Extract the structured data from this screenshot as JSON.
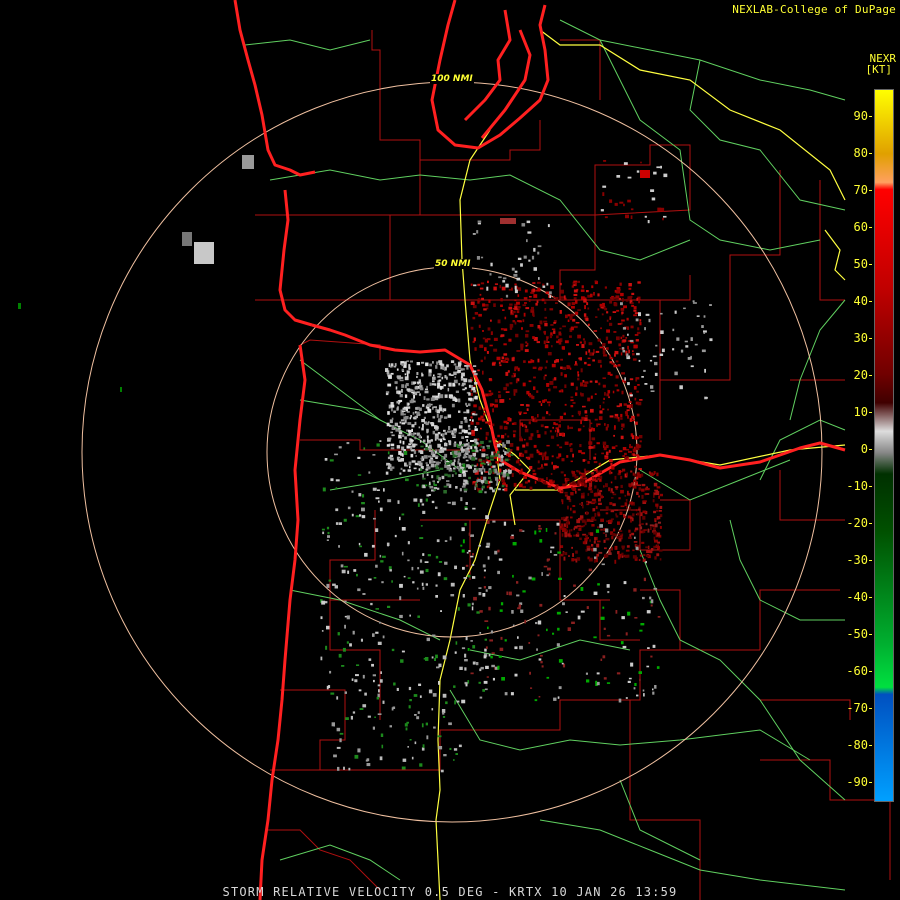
{
  "credit": "NEXLAB-College of DuPage",
  "product": "NEXR",
  "unit": "[KT]",
  "footer": "STORM RELATIVE VELOCITY 0.5 DEG - KRTX 10 JAN 26 13:59",
  "rings": [
    {
      "label": "100 NMI"
    },
    {
      "label": "50 NMI"
    }
  ],
  "legend": {
    "ticks": [
      "90",
      "80",
      "70",
      "60",
      "50",
      "40",
      "30",
      "20",
      "10",
      "0",
      "-10",
      "-20",
      "-30",
      "-40",
      "-50",
      "-60",
      "-70",
      "-80",
      "-90"
    ],
    "colors": {
      "high": "#ffff00",
      "orange": "#ffa060",
      "red": "#ff0000",
      "darkred": "#700000",
      "gray": "#888888",
      "darkgreen": "#005000",
      "green": "#00e040",
      "blue": "#0050c0",
      "lightblue": "#00a0ff"
    }
  },
  "colors": {
    "background": "#000000",
    "coast": "#ff2020",
    "county": "#b01010",
    "road": "#70e070",
    "highway": "#ffff40",
    "ring": "#f0c0a0"
  }
}
